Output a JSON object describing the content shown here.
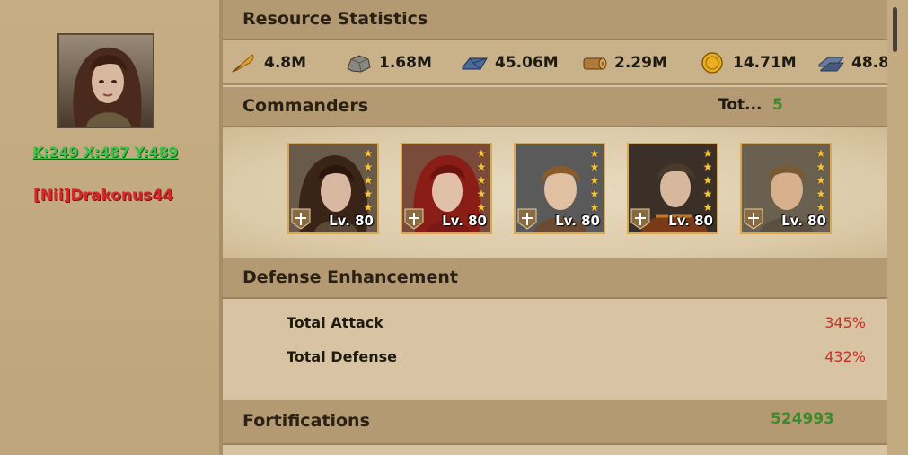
{
  "player": {
    "coords": "K:249 X:487 Y:489",
    "name": "[Nii]Drakonus44"
  },
  "resources": {
    "title": "Resource Statistics",
    "items": [
      {
        "icon": "quill-icon",
        "value": "4.8M"
      },
      {
        "icon": "stone-icon",
        "value": "1.68M"
      },
      {
        "icon": "iron-ingot-icon",
        "value": "45.06M"
      },
      {
        "icon": "wood-log-icon",
        "value": "2.29M"
      },
      {
        "icon": "gold-coin-icon",
        "value": "14.71M"
      },
      {
        "icon": "steel-bar-icon",
        "value": "48.8"
      }
    ]
  },
  "commanders": {
    "title": "Commanders",
    "total_label": "Tot...",
    "total_value": "5",
    "list": [
      {
        "level": "Lv. 80",
        "stars": 5
      },
      {
        "level": "Lv. 80",
        "stars": 5
      },
      {
        "level": "Lv. 80",
        "stars": 5
      },
      {
        "level": "Lv. 80",
        "stars": 5
      },
      {
        "level": "Lv. 80",
        "stars": 5
      }
    ]
  },
  "defense": {
    "title": "Defense Enhancement",
    "stats": [
      {
        "label": "Total Attack",
        "value": "345%"
      },
      {
        "label": "Total Defense",
        "value": "432%"
      }
    ]
  },
  "fortifications": {
    "title": "Fortifications",
    "value": "524993"
  },
  "colors": {
    "positive": "#3e8a2a",
    "bonus": "#c8302c",
    "coords": "#3ec24a",
    "player_name": "#d6282a"
  }
}
